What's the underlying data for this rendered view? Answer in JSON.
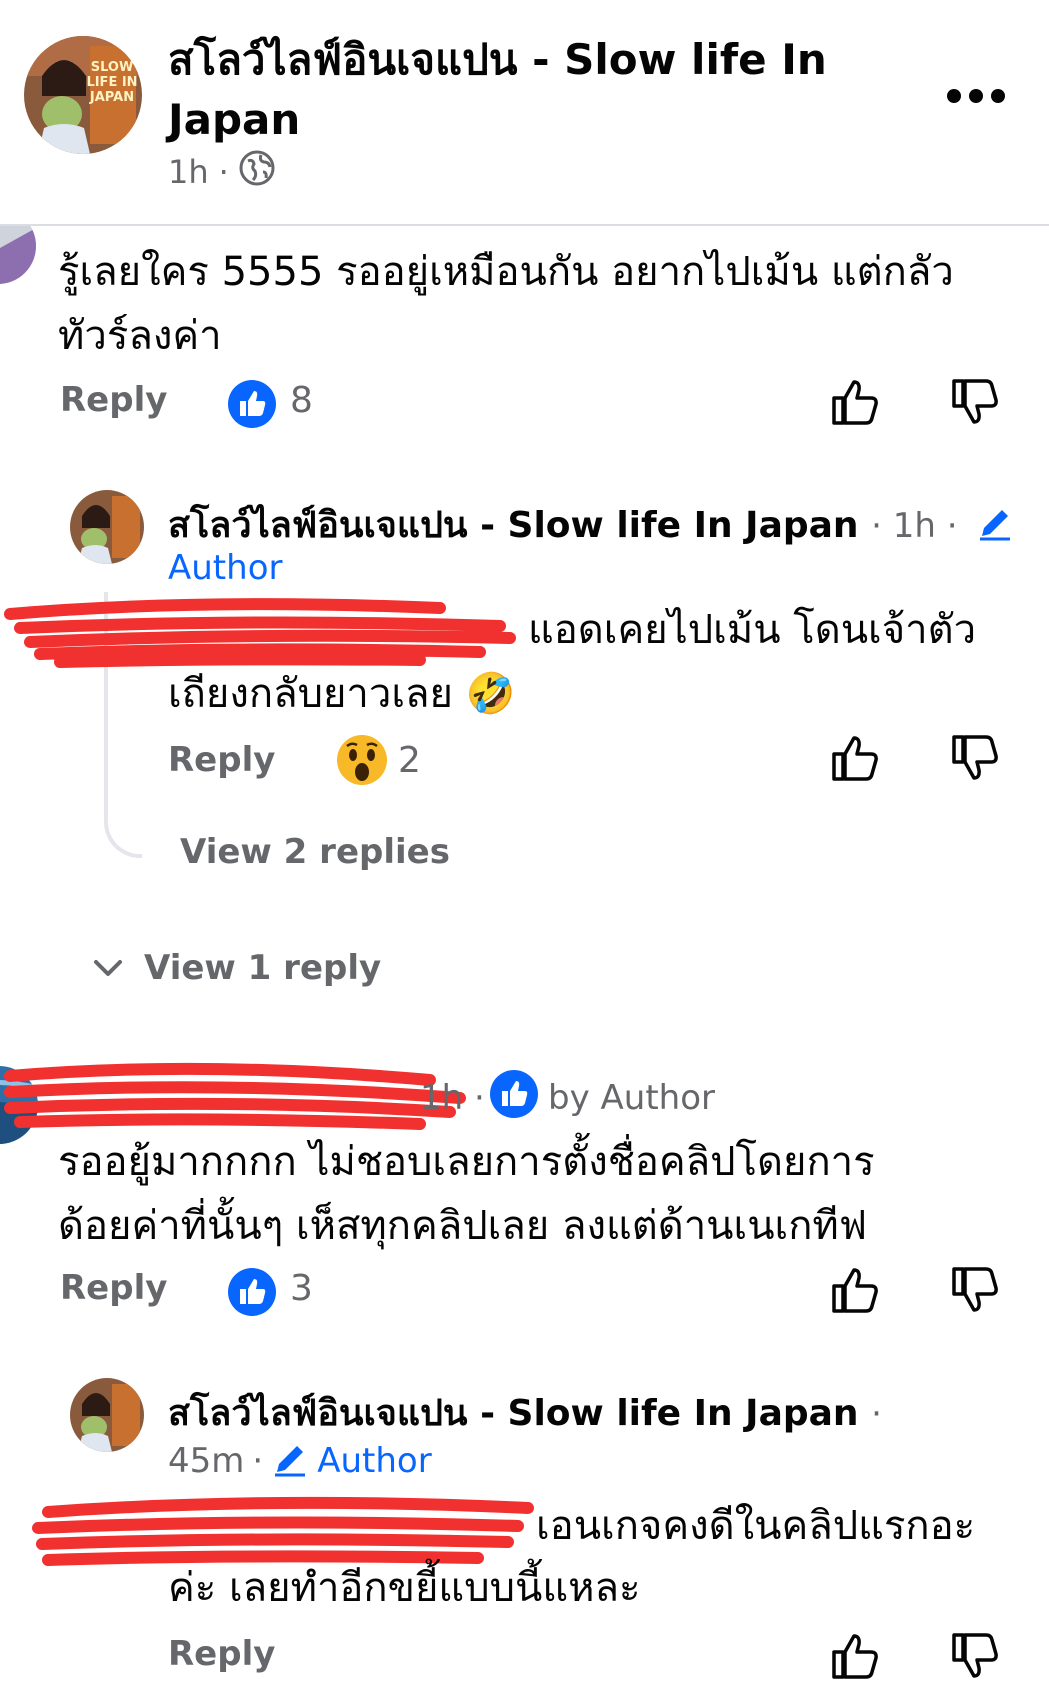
{
  "header": {
    "page_name": "สโลว์ไลฟ์อินเจแปน - Slow life In Japan",
    "time": "1h",
    "dot": "·",
    "audience_icon": "globe-icon",
    "more_icon": "more-horizontal-icon",
    "avatar_text": "SLOW LIFE IN JAPAN"
  },
  "comments": [
    {
      "text": "รู้เลยใคร 5555 รออยู่เหมือนกัน อยากไปเม้น แต่กลัวทัวร์ลงค่า",
      "reply_label": "Reply",
      "reaction_icon": "like-reaction-icon",
      "reaction_count": "8"
    },
    {
      "author": "สโลว์ไลฟ์อินเจแปน - Slow life In Japan",
      "time_meta": "· 1h ·",
      "badge": "Author",
      "text": "แอดเคยไปเม้น โดนเจ้าตัวเถียงกลับยาวเลย 🤣",
      "reply_label": "Reply",
      "reaction_icon": "wow-reaction-icon",
      "reaction_count": "2",
      "view_replies": "View 2 replies"
    },
    {
      "view_reply": "View 1 reply"
    },
    {
      "time_meta": "1h ·",
      "liked_by": "by Author",
      "text_line1": "รออยู้มากกกก ไม่ชอบเลยการตั้งชื่อคลิปโดยการ",
      "text_line2": "ด้อยค่าที่นั้นๆ เห็สทุกคลิปเลย ลงแต่ด้านเนเกทีฟ",
      "reply_label": "Reply",
      "reaction_icon": "like-reaction-icon",
      "reaction_count": "3"
    },
    {
      "author": "สโลว์ไลฟ์อินเจแปน - Slow life In Japan",
      "dot": "·",
      "time": "45m",
      "time_dot": "·",
      "badge": "Author",
      "text_line1": "เอนเกจคงดีในคลิปแรกอะ",
      "text_line2": "ค่ะ เลยทำอีกขยี้แบบนี้แหละ",
      "reply_label": "Reply"
    }
  ],
  "colors": {
    "like_blue": "#0866ff",
    "grey_text": "#65676b",
    "redaction_red": "#f0312f"
  }
}
